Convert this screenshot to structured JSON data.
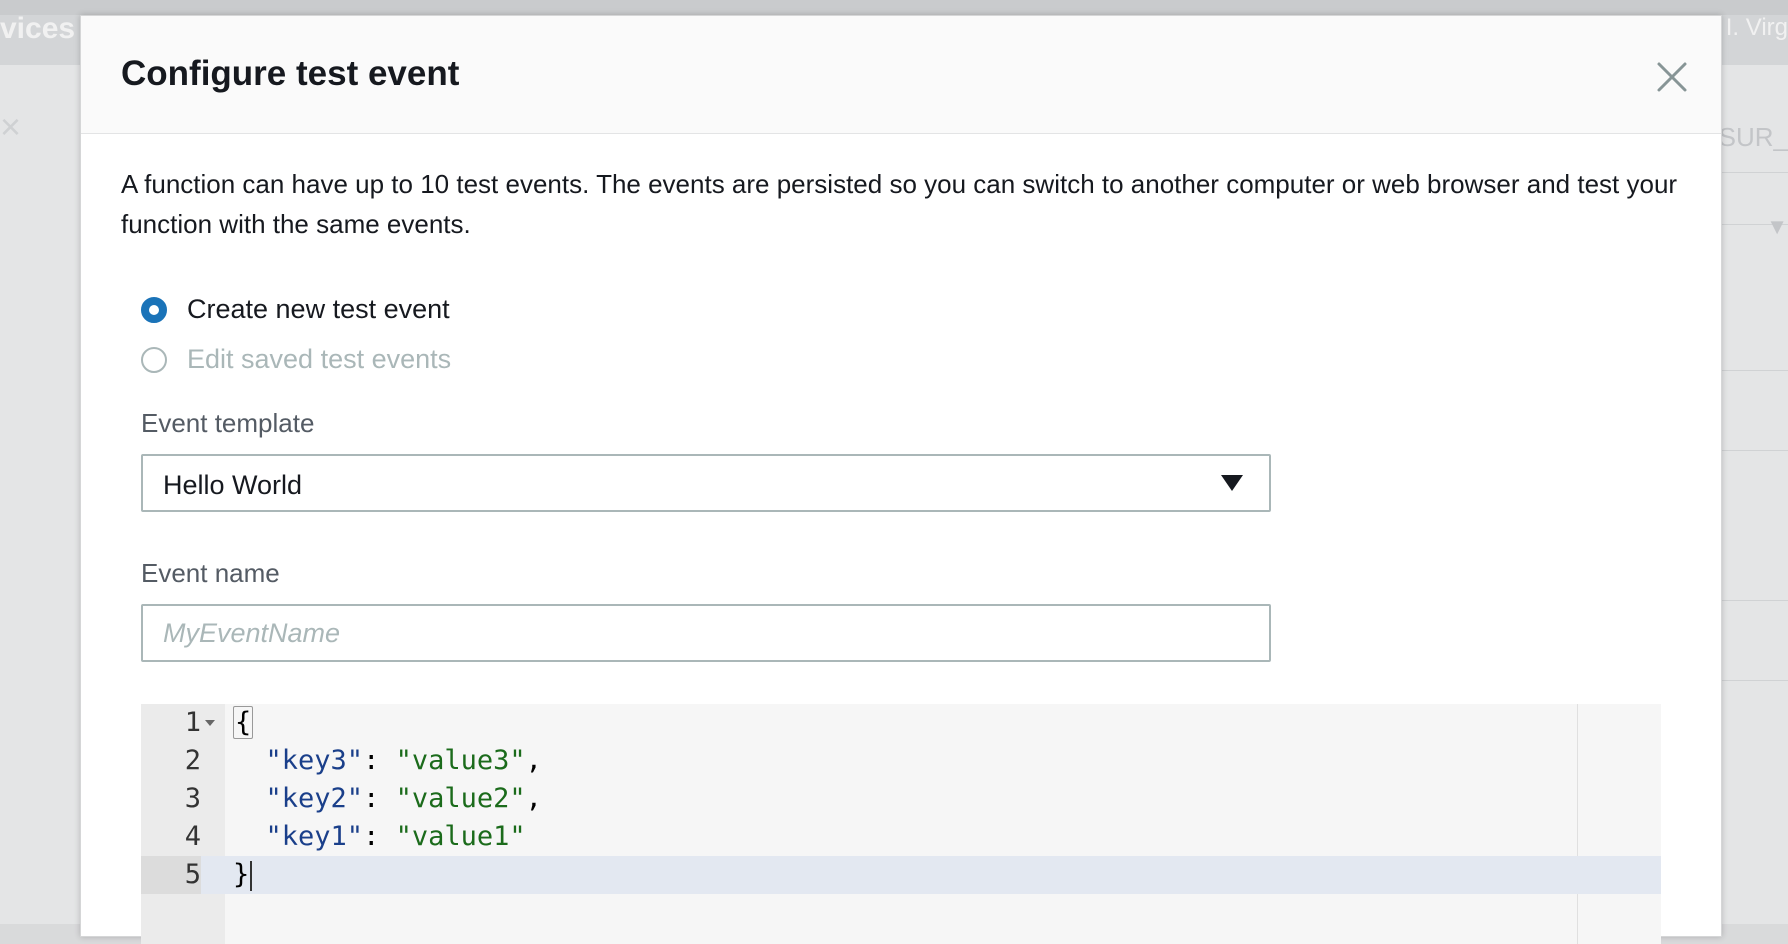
{
  "background": {
    "services_text": "vices",
    "region_text": "I. Virg",
    "sur_text": ":SUR_",
    "close_glyph": "×",
    "caret_glyph": "▼"
  },
  "modal": {
    "title": "Configure test event",
    "close_icon": "close-icon",
    "description": "A function can have up to 10 test events. The events are persisted so you can switch to another computer or web browser and test your function with the same events.",
    "radio_options": [
      {
        "label": "Create new test event",
        "checked": true,
        "disabled": false
      },
      {
        "label": "Edit saved test events",
        "checked": false,
        "disabled": true
      }
    ],
    "event_template": {
      "label": "Event template",
      "selected": "Hello World"
    },
    "event_name": {
      "label": "Event name",
      "value": "",
      "placeholder": "MyEventName"
    },
    "editor": {
      "lines": [
        {
          "number": "1",
          "tokens": [
            {
              "t": "bracket",
              "v": "{"
            }
          ]
        },
        {
          "number": "2",
          "tokens": [
            {
              "t": "plain",
              "v": "  "
            },
            {
              "t": "key",
              "v": "\"key3\""
            },
            {
              "t": "plain",
              "v": ": "
            },
            {
              "t": "str",
              "v": "\"value3\""
            },
            {
              "t": "plain",
              "v": ","
            }
          ]
        },
        {
          "number": "3",
          "tokens": [
            {
              "t": "plain",
              "v": "  "
            },
            {
              "t": "key",
              "v": "\"key2\""
            },
            {
              "t": "plain",
              "v": ": "
            },
            {
              "t": "str",
              "v": "\"value2\""
            },
            {
              "t": "plain",
              "v": ","
            }
          ]
        },
        {
          "number": "4",
          "tokens": [
            {
              "t": "plain",
              "v": "  "
            },
            {
              "t": "key",
              "v": "\"key1\""
            },
            {
              "t": "plain",
              "v": ": "
            },
            {
              "t": "str",
              "v": "\"value1\""
            }
          ]
        },
        {
          "number": "5",
          "tokens": [
            {
              "t": "plain",
              "v": "}"
            }
          ]
        }
      ],
      "active_line": 5,
      "colors": {
        "key": "#1a3f8a",
        "string": "#1b6b1b",
        "active_line": "#e3e8f1"
      }
    }
  },
  "colors": {
    "radio_accent": "#1a73b8",
    "disabled_text": "#aab7b8",
    "title_text": "#16191f"
  }
}
